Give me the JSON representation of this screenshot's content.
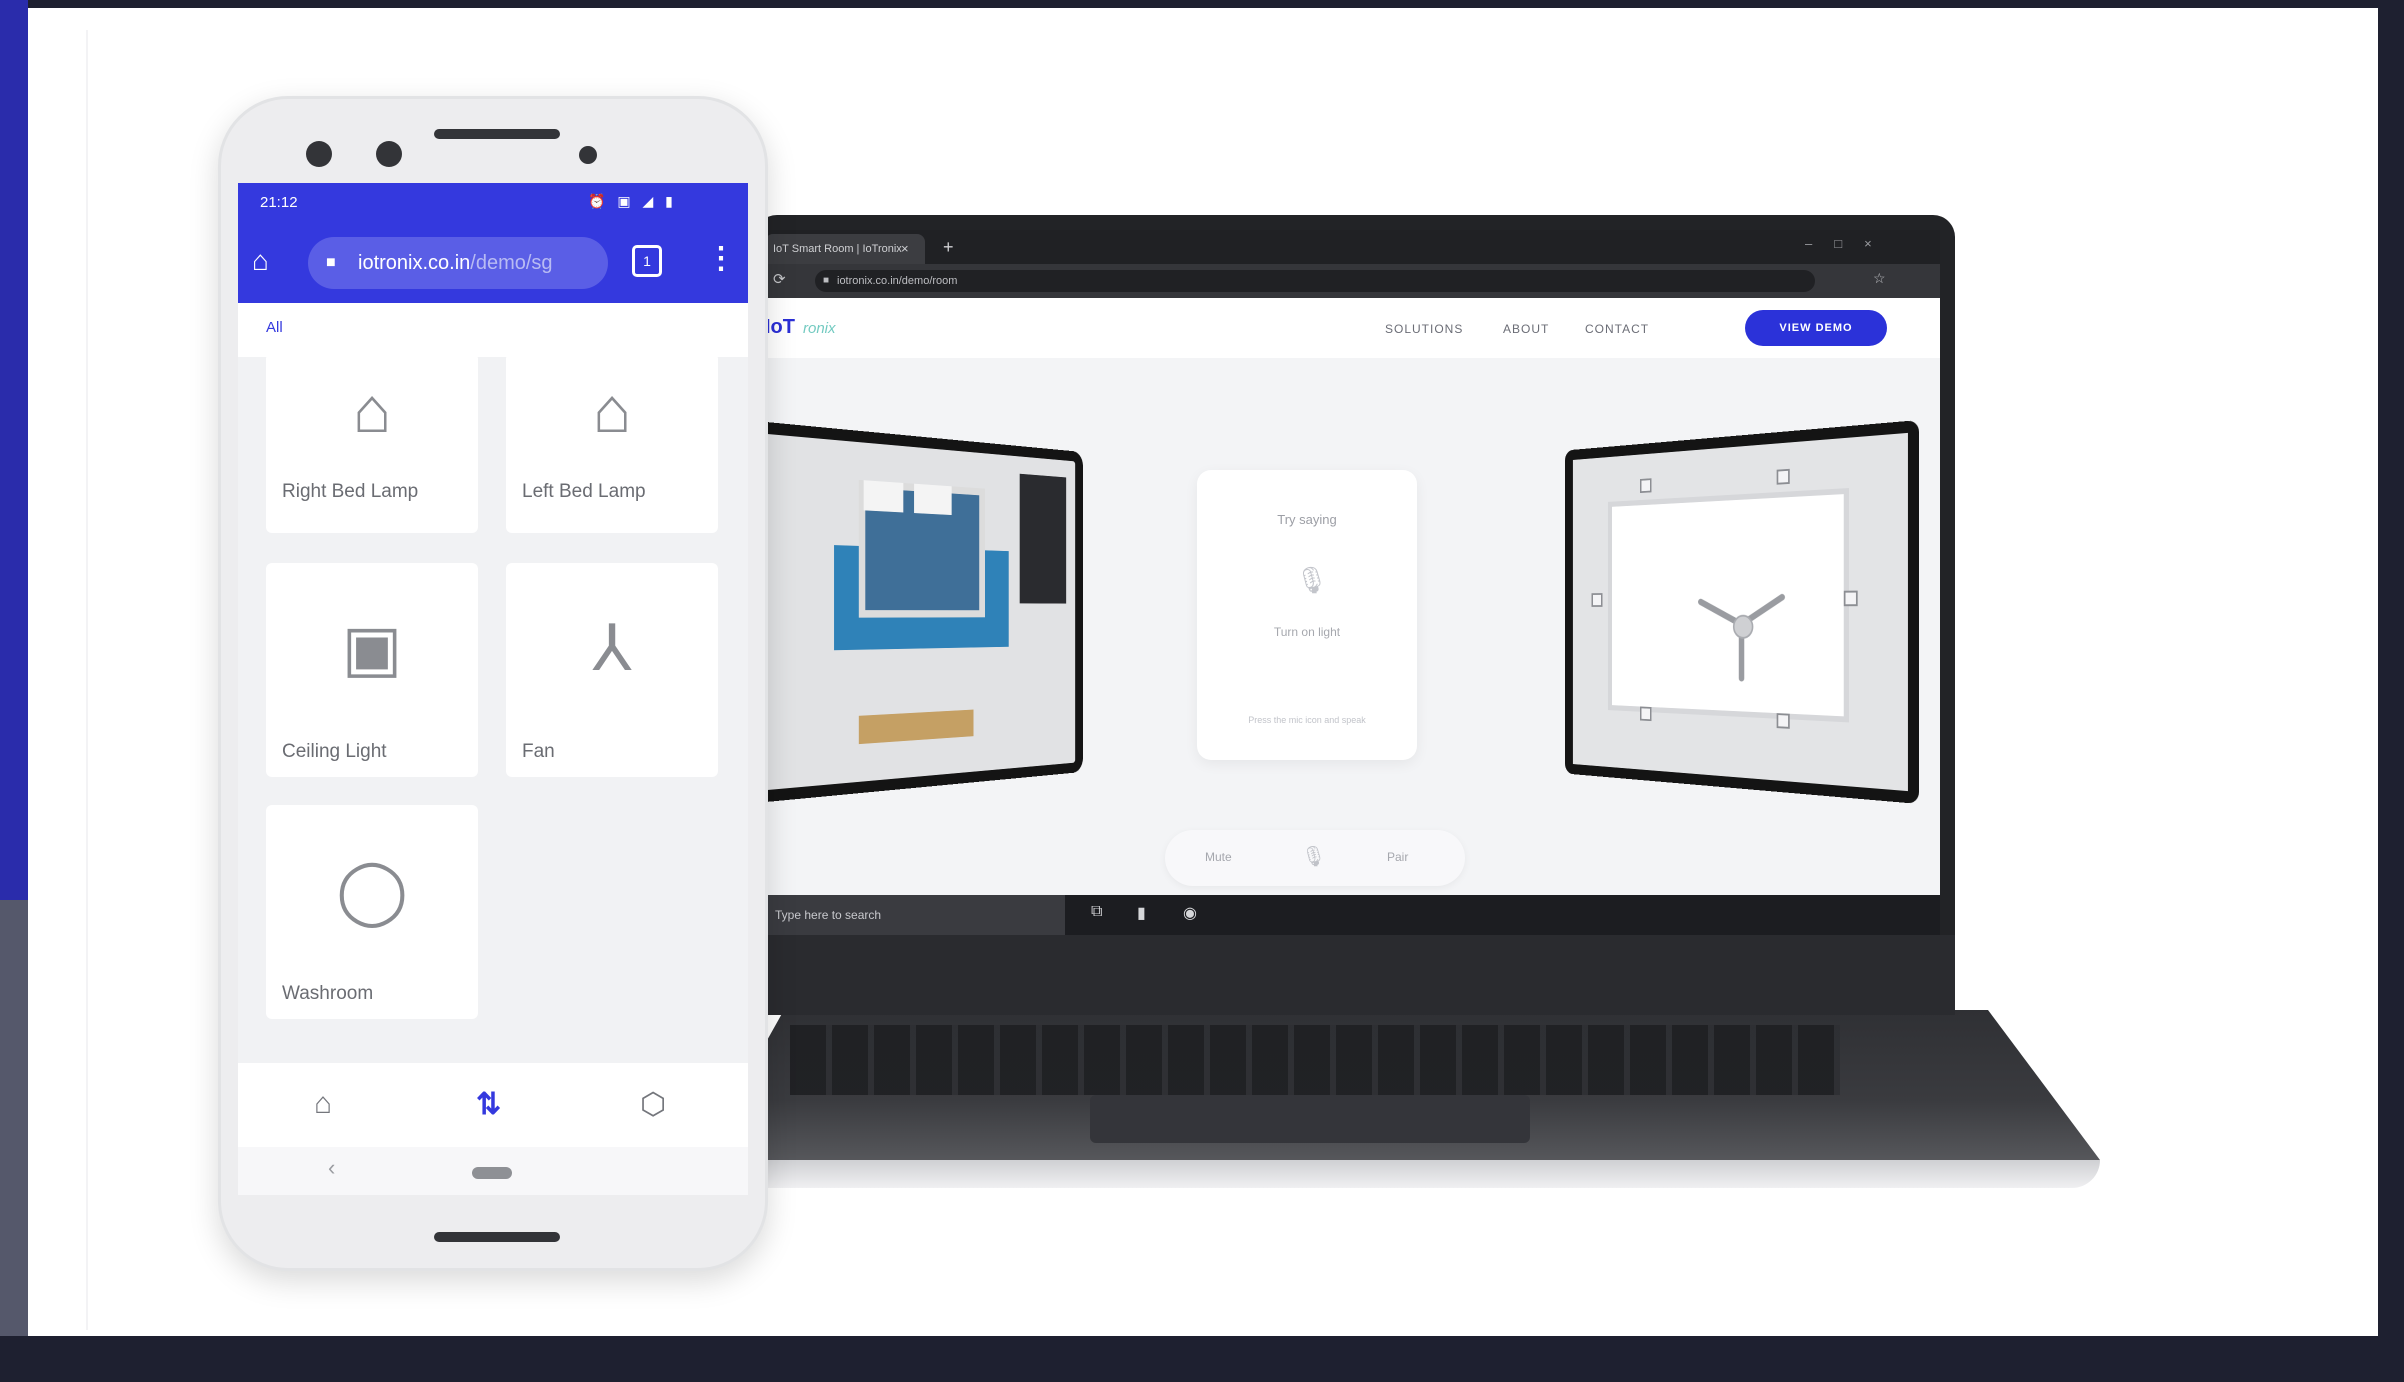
{
  "phone": {
    "status": {
      "time": "21:12",
      "icons": "⏰ ▣ ◢ ▮"
    },
    "url": {
      "domain": "iotronix.co.in",
      "path": "/demo/sg"
    },
    "filter_label": "All",
    "devices": [
      {
        "label": "Right Bed Lamp",
        "icon": "lamp-icon",
        "glyph": "⌂"
      },
      {
        "label": "Left Bed Lamp",
        "icon": "lamp-icon",
        "glyph": "⌂"
      },
      {
        "label": "Ceiling Light",
        "icon": "ceiling-light-icon",
        "glyph": "▣"
      },
      {
        "label": "Fan",
        "icon": "fan-icon",
        "glyph": "⅄"
      },
      {
        "label": "Washroom",
        "icon": "bulb-icon",
        "glyph": "◯"
      }
    ],
    "bottom_nav": [
      {
        "icon": "home-icon",
        "glyph": "⌂"
      },
      {
        "icon": "controls-icon",
        "glyph": "⇅"
      },
      {
        "icon": "settings-icon",
        "glyph": "⬡"
      }
    ],
    "accent_color": "#3439de"
  },
  "laptop": {
    "browser": {
      "tab_title": "IoT Smart Room | IoTronix",
      "url": "iotronix.co.in/demo/room"
    },
    "site": {
      "logo": "IoT",
      "logo_sub": "ronix",
      "nav_links": [
        "SOLUTIONS",
        "ABOUT",
        "CONTACT"
      ],
      "cta": "VIEW DEMO"
    },
    "voice_card": {
      "try_saying": "Try saying",
      "command": "Turn on light",
      "hint": "Press the mic icon and speak"
    },
    "control_pill": {
      "mute": "Mute",
      "pair": "Pair"
    },
    "taskbar": {
      "search_placeholder": "Type here to search"
    }
  }
}
